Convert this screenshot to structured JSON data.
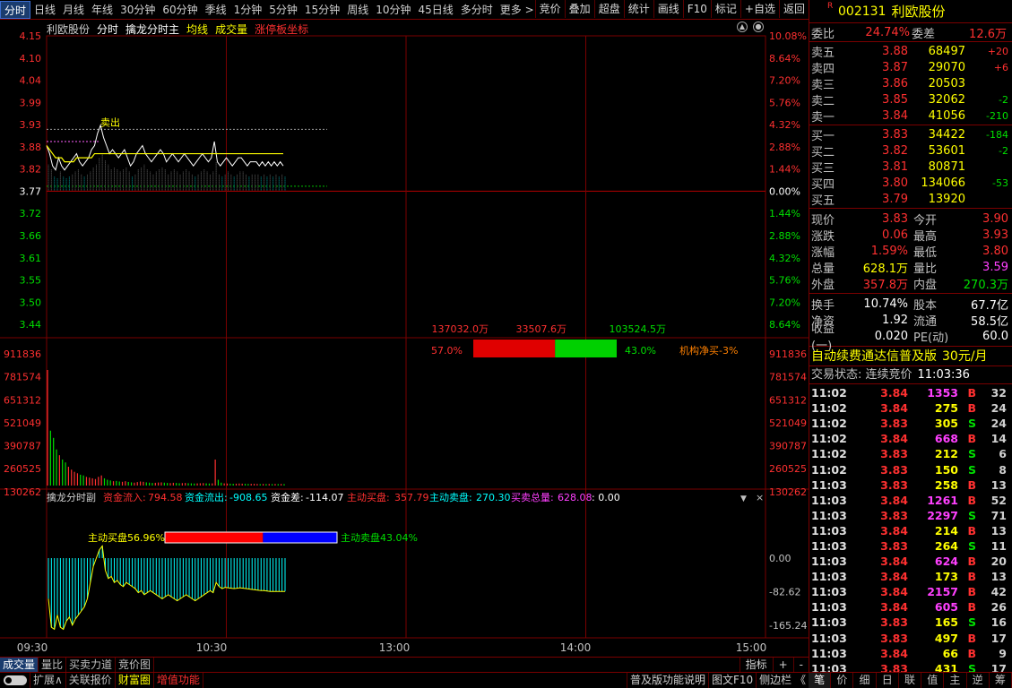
{
  "periods": [
    "分时",
    "日线",
    "月线",
    "年线",
    "30分钟",
    "60分钟",
    "季线",
    "1分钟",
    "5分钟",
    "15分钟",
    "周线",
    "10分钟",
    "45日线",
    "多分时",
    "更多 >"
  ],
  "active_period": "分时",
  "toolbar": [
    "竞价",
    "叠加",
    "超盘",
    "统计",
    "画线",
    "F10",
    "标记",
    "+自选",
    "返回"
  ],
  "chart_header": {
    "name": "利欧股份",
    "fenshi": "分时",
    "indicator": "擒龙分时主",
    "ma": "均线",
    "vol": "成交量",
    "limit": "涨停板坐标"
  },
  "price_axis": {
    "left": [
      "4.15",
      "4.10",
      "4.04",
      "3.99",
      "3.93",
      "3.88",
      "3.82",
      "3.77",
      "3.72",
      "3.66",
      "3.61",
      "3.55",
      "3.50",
      "3.44"
    ],
    "right": [
      "10.08%",
      "8.64%",
      "7.20%",
      "5.76%",
      "4.32%",
      "2.88%",
      "1.44%",
      "0.00%",
      "1.44%",
      "2.88%",
      "4.32%",
      "5.76%",
      "7.20%",
      "8.64%"
    ]
  },
  "volume_axis": [
    "911836",
    "781574",
    "651312",
    "521049",
    "390787",
    "260525",
    "130262"
  ],
  "time_axis": [
    "09:30",
    "10:30",
    "13:00",
    "14:00",
    "15:00"
  ],
  "sell_marker": "卖出",
  "flow_box": {
    "left_amount": "137032.0万",
    "mid_amount": "33507.6万",
    "right_amount": "103524.5万",
    "left_pct": "57.0%",
    "right_pct": "43.0%",
    "net_label": "机构净买-3%",
    "left_ratio": 0.57
  },
  "sub_panel": {
    "title": "擒龙分时副",
    "inflow_label": "资金流入:",
    "inflow": "794.58",
    "outflow_label": "资金流出:",
    "outflow": "-908.65",
    "diff_label": "资金差:",
    "diff": "-114.07",
    "buy_label": "主动买盘:",
    "buy": "357.79",
    "sell_label": "主动卖盘:",
    "sell": "270.30",
    "total_label": "买卖总量:",
    "total": "628.08",
    "tail": ": 0.00",
    "buy_pct_label": "主动买盘56.96%",
    "sell_pct_label": "主动卖盘43.04%",
    "buy_ratio": 0.5696,
    "axis": [
      "0.00",
      "-82.62",
      "-165.24"
    ]
  },
  "chart_data": {
    "type": "line",
    "x_range": [
      "09:30",
      "15:00"
    ],
    "price_ylim": [
      3.44,
      4.15
    ],
    "prev_close": 3.77,
    "price_series": {
      "name": "price",
      "values": [
        3.88,
        3.86,
        3.83,
        3.82,
        3.85,
        3.83,
        3.82,
        3.83,
        3.84,
        3.85,
        3.86,
        3.84,
        3.83,
        3.84,
        3.85,
        3.87,
        3.88,
        3.91,
        3.93,
        3.9,
        3.88,
        3.86,
        3.87,
        3.86,
        3.85,
        3.86,
        3.87,
        3.85,
        3.83,
        3.84,
        3.86,
        3.87,
        3.88,
        3.86,
        3.85,
        3.84,
        3.85,
        3.86,
        3.87,
        3.86,
        3.84,
        3.85,
        3.86,
        3.85,
        3.84,
        3.85,
        3.86,
        3.85,
        3.84,
        3.83,
        3.84,
        3.85,
        3.86,
        3.85,
        3.84,
        3.85,
        3.89,
        3.84,
        3.83,
        3.84,
        3.85,
        3.84,
        3.83,
        3.84,
        3.85,
        3.85,
        3.84,
        3.83,
        3.84,
        3.84,
        3.84,
        3.83,
        3.84,
        3.83,
        3.84,
        3.83,
        3.84,
        3.83,
        3.84,
        3.83
      ]
    },
    "avg_series": {
      "name": "均线",
      "values": [
        3.88,
        3.87,
        3.86,
        3.85,
        3.85,
        3.85,
        3.84,
        3.84,
        3.84,
        3.84,
        3.85,
        3.85,
        3.85,
        3.85,
        3.85,
        3.85,
        3.86,
        3.86,
        3.86,
        3.86,
        3.86,
        3.86,
        3.86,
        3.86,
        3.86,
        3.86,
        3.86,
        3.86,
        3.86,
        3.86,
        3.86,
        3.86,
        3.86,
        3.86,
        3.86,
        3.86,
        3.86,
        3.86,
        3.86,
        3.86,
        3.86,
        3.86,
        3.86,
        3.86,
        3.86,
        3.86,
        3.86,
        3.86,
        3.86,
        3.86,
        3.86,
        3.86,
        3.86,
        3.86,
        3.86,
        3.86,
        3.86,
        3.86,
        3.86,
        3.86,
        3.86,
        3.86,
        3.86,
        3.86,
        3.86,
        3.86,
        3.86,
        3.86,
        3.86,
        3.86,
        3.86,
        3.86,
        3.86,
        3.86,
        3.86,
        3.86,
        3.86,
        3.86,
        3.86,
        3.86
      ]
    },
    "volume_ylim": [
      0,
      911836
    ],
    "volume_values": [
      800000,
      380000,
      330000,
      250000,
      210000,
      180000,
      160000,
      130000,
      110000,
      95000,
      85000,
      75000,
      70000,
      60000,
      55000,
      50000,
      45000,
      60000,
      70000,
      50000,
      40000,
      35000,
      30000,
      32000,
      28000,
      26000,
      30000,
      25000,
      22000,
      20000,
      24000,
      28000,
      26000,
      22000,
      20000,
      18000,
      19000,
      21000,
      22000,
      20000,
      18000,
      17000,
      19000,
      18000,
      16000,
      17000,
      18000,
      16000,
      15000,
      14000,
      15000,
      16000,
      17000,
      15000,
      14000,
      15000,
      180000,
      40000,
      20000,
      15000,
      14000,
      13000,
      12000,
      13000,
      14000,
      13000,
      12000,
      11000,
      12000,
      12000,
      11000,
      10000,
      11000,
      10000,
      11000,
      10000,
      11000,
      10000,
      11000,
      10000
    ],
    "flow_ylim": [
      -200,
      0
    ],
    "flow_values": [
      -100,
      -170,
      -175,
      -140,
      -170,
      -175,
      -155,
      -145,
      -165,
      -150,
      -140,
      -130,
      -120,
      -100,
      -60,
      -20,
      0,
      20,
      30,
      -30,
      -50,
      -45,
      -60,
      -55,
      -65,
      -70,
      -60,
      -65,
      -70,
      -75,
      -85,
      -80,
      -90,
      -85,
      -80,
      -85,
      -90,
      -95,
      -100,
      -95,
      -90,
      -95,
      -100,
      -105,
      -100,
      -95,
      -90,
      -95,
      -100,
      -105,
      -100,
      -95,
      -90,
      -85,
      -80,
      -85,
      -60,
      -70,
      -75,
      -72,
      -73,
      -74,
      -75,
      -74,
      -73,
      -74,
      -75,
      -76,
      -77,
      -78,
      -79,
      -80,
      -80,
      -81,
      -82,
      -82,
      -82,
      -82,
      -82,
      -82
    ]
  },
  "stock": {
    "flag": "R",
    "code": "002131",
    "name": "利欧股份"
  },
  "ratio": {
    "wb_label": "委比",
    "wb": "24.74%",
    "wc_label": "委差",
    "wc": "12.6万"
  },
  "asks": [
    {
      "label": "卖五",
      "price": "3.88",
      "vol": "68497",
      "chg": "+20"
    },
    {
      "label": "卖四",
      "price": "3.87",
      "vol": "29070",
      "chg": "+6"
    },
    {
      "label": "卖三",
      "price": "3.86",
      "vol": "20503",
      "chg": ""
    },
    {
      "label": "卖二",
      "price": "3.85",
      "vol": "32062",
      "chg": "-2"
    },
    {
      "label": "卖一",
      "price": "3.84",
      "vol": "41056",
      "chg": "-210"
    }
  ],
  "bids": [
    {
      "label": "买一",
      "price": "3.83",
      "vol": "34422",
      "chg": "-184"
    },
    {
      "label": "买二",
      "price": "3.82",
      "vol": "53601",
      "chg": "-2"
    },
    {
      "label": "买三",
      "price": "3.81",
      "vol": "80871",
      "chg": ""
    },
    {
      "label": "买四",
      "price": "3.80",
      "vol": "134066",
      "chg": "-53"
    },
    {
      "label": "买五",
      "price": "3.79",
      "vol": "13920",
      "chg": ""
    }
  ],
  "quote": [
    {
      "l1": "现价",
      "v1": "3.83",
      "c1": "red",
      "l2": "今开",
      "v2": "3.90",
      "c2": "red"
    },
    {
      "l1": "涨跌",
      "v1": "0.06",
      "c1": "red",
      "l2": "最高",
      "v2": "3.93",
      "c2": "red"
    },
    {
      "l1": "涨幅",
      "v1": "1.59%",
      "c1": "red",
      "l2": "最低",
      "v2": "3.80",
      "c2": "red"
    },
    {
      "l1": "总量",
      "v1": "628.1万",
      "c1": "yellow",
      "l2": "量比",
      "v2": "3.59",
      "c2": "magenta"
    },
    {
      "l1": "外盘",
      "v1": "357.8万",
      "c1": "red",
      "l2": "内盘",
      "v2": "270.3万",
      "c2": "green"
    }
  ],
  "fundamentals": [
    {
      "l1": "换手",
      "v1": "10.74%",
      "l2": "股本",
      "v2": "67.7亿"
    },
    {
      "l1": "净资",
      "v1": "1.92",
      "l2": "流通",
      "v2": "58.5亿"
    },
    {
      "l1": "收益(一)",
      "v1": "0.020",
      "l2": "PE(动)",
      "v2": "60.0"
    }
  ],
  "ad": {
    "text": "自动续费通达信普及版",
    "price": "30元/月"
  },
  "trade_status": {
    "label": "交易状态: 连续竞价",
    "time": "11:03:36"
  },
  "ticks": [
    {
      "t": "11:02",
      "p": "3.84",
      "v": "1353",
      "vc": "magenta",
      "bs": "B",
      "n": "32"
    },
    {
      "t": "11:02",
      "p": "3.84",
      "v": "275",
      "vc": "yellow",
      "bs": "B",
      "n": "24"
    },
    {
      "t": "11:02",
      "p": "3.83",
      "v": "305",
      "vc": "yellow",
      "bs": "S",
      "n": "24"
    },
    {
      "t": "11:02",
      "p": "3.84",
      "v": "668",
      "vc": "magenta",
      "bs": "B",
      "n": "14"
    },
    {
      "t": "11:02",
      "p": "3.83",
      "v": "212",
      "vc": "yellow",
      "bs": "S",
      "n": "6"
    },
    {
      "t": "11:02",
      "p": "3.83",
      "v": "150",
      "vc": "yellow",
      "bs": "S",
      "n": "8"
    },
    {
      "t": "11:03",
      "p": "3.83",
      "v": "258",
      "vc": "yellow",
      "bs": "B",
      "n": "13"
    },
    {
      "t": "11:03",
      "p": "3.84",
      "v": "1261",
      "vc": "magenta",
      "bs": "B",
      "n": "52"
    },
    {
      "t": "11:03",
      "p": "3.83",
      "v": "2297",
      "vc": "magenta",
      "bs": "S",
      "n": "71"
    },
    {
      "t": "11:03",
      "p": "3.84",
      "v": "214",
      "vc": "yellow",
      "bs": "B",
      "n": "13"
    },
    {
      "t": "11:03",
      "p": "3.83",
      "v": "264",
      "vc": "yellow",
      "bs": "S",
      "n": "11"
    },
    {
      "t": "11:03",
      "p": "3.84",
      "v": "624",
      "vc": "magenta",
      "bs": "B",
      "n": "20"
    },
    {
      "t": "11:03",
      "p": "3.84",
      "v": "173",
      "vc": "yellow",
      "bs": "B",
      "n": "13"
    },
    {
      "t": "11:03",
      "p": "3.84",
      "v": "2157",
      "vc": "magenta",
      "bs": "B",
      "n": "42"
    },
    {
      "t": "11:03",
      "p": "3.84",
      "v": "605",
      "vc": "magenta",
      "bs": "B",
      "n": "26"
    },
    {
      "t": "11:03",
      "p": "3.83",
      "v": "165",
      "vc": "yellow",
      "bs": "S",
      "n": "16"
    },
    {
      "t": "11:03",
      "p": "3.83",
      "v": "497",
      "vc": "yellow",
      "bs": "B",
      "n": "17"
    },
    {
      "t": "11:03",
      "p": "3.84",
      "v": "66",
      "vc": "yellow",
      "bs": "B",
      "n": "9"
    },
    {
      "t": "11:03",
      "p": "3.83",
      "v": "431",
      "vc": "yellow",
      "bs": "S",
      "n": "17"
    }
  ],
  "side_tabs": [
    "笔",
    "价",
    "细",
    "日",
    "联",
    "值",
    "主",
    "逆",
    "筹"
  ],
  "bottom_tabs": [
    "成交量",
    "量比",
    "买卖力道",
    "竞价图"
  ],
  "bottom_right": [
    "指标",
    "+",
    "-"
  ],
  "status_items": [
    "扩展∧",
    "关联报价",
    "财富圈",
    "增值功能"
  ],
  "status_right": [
    "普及版功能说明",
    "图文F10",
    "侧边栏 《"
  ],
  "colors": {
    "up": "#ff3030",
    "down": "#00e000",
    "price_line": "#ffffff",
    "avg_line": "#ffff00",
    "grid": "#7a0000",
    "flow_bar": "#00ffff",
    "buy_bar": "#ff0000",
    "sell_bar": "#0000ff"
  }
}
